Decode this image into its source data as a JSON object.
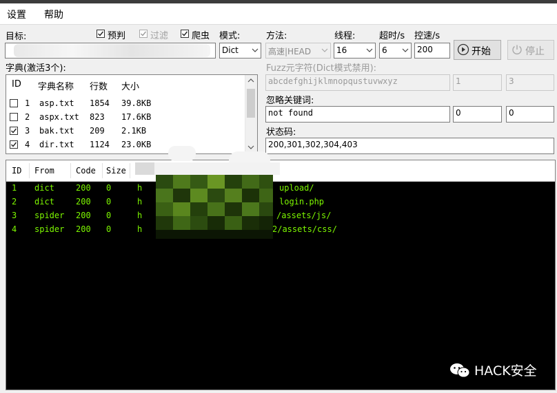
{
  "menu": {
    "settings": "设置",
    "help": "帮助"
  },
  "target": {
    "label": "目标:",
    "value": ""
  },
  "options": {
    "precheck": {
      "label": "预判",
      "checked": true
    },
    "filter": {
      "label": "过滤",
      "checked": true,
      "disabled": true
    },
    "crawler": {
      "label": "爬虫",
      "checked": true
    }
  },
  "mode": {
    "label": "模式:",
    "value": "Dict"
  },
  "method": {
    "label": "方法:",
    "value": "高速|HEAD"
  },
  "threads": {
    "label": "线程:",
    "value": "16"
  },
  "timeout": {
    "label": "超时/s",
    "value": "6"
  },
  "rate": {
    "label": "控速/s",
    "value": "200"
  },
  "buttons": {
    "start": "开始",
    "stop": "停止"
  },
  "dict": {
    "label": "字典(激活3个):",
    "columns": [
      "ID",
      "字典名称",
      "行数",
      "大小"
    ],
    "rows": [
      {
        "id": "1",
        "name": "asp.txt",
        "lines": "1854",
        "size": "39.8KB",
        "checked": false
      },
      {
        "id": "2",
        "name": "aspx.txt",
        "lines": "823",
        "size": "17.6KB",
        "checked": false
      },
      {
        "id": "3",
        "name": "bak.txt",
        "lines": "209",
        "size": "2.1KB",
        "checked": true
      },
      {
        "id": "4",
        "name": "dir.txt",
        "lines": "1124",
        "size": "23.0KB",
        "checked": true
      }
    ]
  },
  "fuzz": {
    "label": "Fuzz元字符(Dict模式禁用):",
    "charset": "abcdefghijklmnopqustuvwxyz",
    "min": "1",
    "max": "3"
  },
  "ignore": {
    "label": "忽略关键词:",
    "value": "not found",
    "n1": "0",
    "n2": "0"
  },
  "status": {
    "label": "状态码:",
    "value": "200,301,302,304,403"
  },
  "results": {
    "columns": [
      "ID",
      "From",
      "Code",
      "Size",
      ""
    ],
    "rows": [
      {
        "id": "1",
        "from": "dict",
        "code": "200",
        "size": "0",
        "url_head": "h",
        "url_tail": "upload/"
      },
      {
        "id": "2",
        "from": "dict",
        "code": "200",
        "size": "0",
        "url_head": "h",
        "url_tail": "login.php"
      },
      {
        "id": "3",
        "from": "spider",
        "code": "200",
        "size": "0",
        "url_head": "h",
        "url_tail": "/assets/js/"
      },
      {
        "id": "4",
        "from": "spider",
        "code": "200",
        "size": "0",
        "url_head": "h",
        "url_tail": "2/assets/css/"
      }
    ]
  },
  "watermark": {
    "text": "HACK安全",
    "icon": "wechat-icon"
  },
  "colors": {
    "result_text": "#7df700",
    "result_bg": "#000000",
    "accent": "#0078d7"
  }
}
